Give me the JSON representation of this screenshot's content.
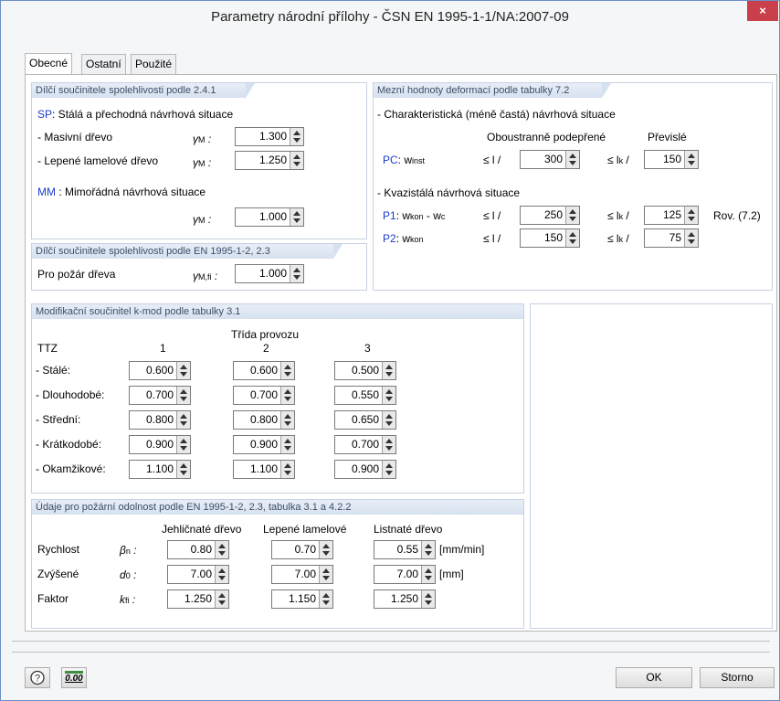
{
  "window": {
    "title": "Parametry národní přílohy - ČSN EN 1995-1-1/NA:2007-09",
    "close": "×"
  },
  "tabs": [
    "Obecné",
    "Ostatní",
    "Použité normy"
  ],
  "g1": {
    "header": "Dílčí součinitele spolehlivosti podle 2.4.1",
    "sp_code": "SP",
    "sp_text": ": Stálá a přechodná návrhová situace",
    "masivni": "- Masivní dřevo",
    "lepene": "- Lepené lamelové dřevo",
    "gamma": "γ",
    "m": "M",
    "colon": " :",
    "v_masivni": "1.300",
    "v_lepene": "1.250",
    "mm_code": "MM",
    "mm_text": " : Mimořádná návrhová situace",
    "v_mm": "1.000"
  },
  "g2": {
    "header": "Dílčí součinitele spolehlivosti podle EN 1995-1-2, 2.3",
    "label": "Pro požár dřeva",
    "sub": "M,fi",
    "v": "1.000"
  },
  "g3": {
    "header": "Mezní hodnoty deformací podle tabulky 7.2",
    "char_title": "- Charakteristická (méně častá) návrhová situace",
    "col1": "Oboustranně podepřené",
    "col2": "Převislé",
    "pc_code": "PC",
    "pc_sym": "w",
    "pc_sub": "inst",
    "le_l": "≤ l /",
    "le_lk": "≤ l",
    "k": "k",
    "slash": " /",
    "pc_v1": "300",
    "pc_v2": "150",
    "kvazi_title": "- Kvazistálá návrhová situace",
    "p1_code": "P1",
    "p1_sym_a": "w",
    "p1_sub_a": "kon",
    "p1_minus": " - w",
    "p1_sub_b": "c",
    "p1_v1": "250",
    "p1_v2": "125",
    "rov": "Rov. (7.2)",
    "p2_code": "P2",
    "p2_sym": "w",
    "p2_sub": "kon",
    "p2_v1": "150",
    "p2_v2": "75"
  },
  "g4": {
    "header": "Modifikační součinitel k-mod podle tabulky 3.1",
    "trida": "Třída provozu",
    "ttz": "TTZ",
    "cols": [
      "1",
      "2",
      "3"
    ],
    "rows": [
      {
        "label": "- Stálé:",
        "v": [
          "0.600",
          "0.600",
          "0.500"
        ]
      },
      {
        "label": "- Dlouhodobé:",
        "v": [
          "0.700",
          "0.700",
          "0.550"
        ]
      },
      {
        "label": "- Střední:",
        "v": [
          "0.800",
          "0.800",
          "0.650"
        ]
      },
      {
        "label": "- Krátkodobé:",
        "v": [
          "0.900",
          "0.900",
          "0.700"
        ]
      },
      {
        "label": "- Okamžikové:",
        "v": [
          "1.100",
          "1.100",
          "0.900"
        ]
      }
    ]
  },
  "g5": {
    "header": "Údaje pro požární odolnost podle EN 1995-1-2, 2.3, tabulka 3.1 a 4.2.2",
    "cols": [
      "Jehličnaté dřevo",
      "Lepené lamelové",
      "Listnaté dřevo"
    ],
    "rows": [
      {
        "label": "Rychlost",
        "sym": "β",
        "sub": "n",
        "v": [
          "0.80",
          "0.70",
          "0.55"
        ],
        "unit": "[mm/min]"
      },
      {
        "label": "Zvýšené",
        "sym": "d",
        "sub": "0",
        "v": [
          "7.00",
          "7.00",
          "7.00"
        ],
        "unit": "[mm]"
      },
      {
        "label": "Faktor",
        "sym": "k",
        "sub": "fi",
        "v": [
          "1.250",
          "1.150",
          "1.250"
        ],
        "unit": ""
      }
    ]
  },
  "footer": {
    "ok": "OK",
    "cancel": "Storno",
    "format_icon": "0.00"
  }
}
